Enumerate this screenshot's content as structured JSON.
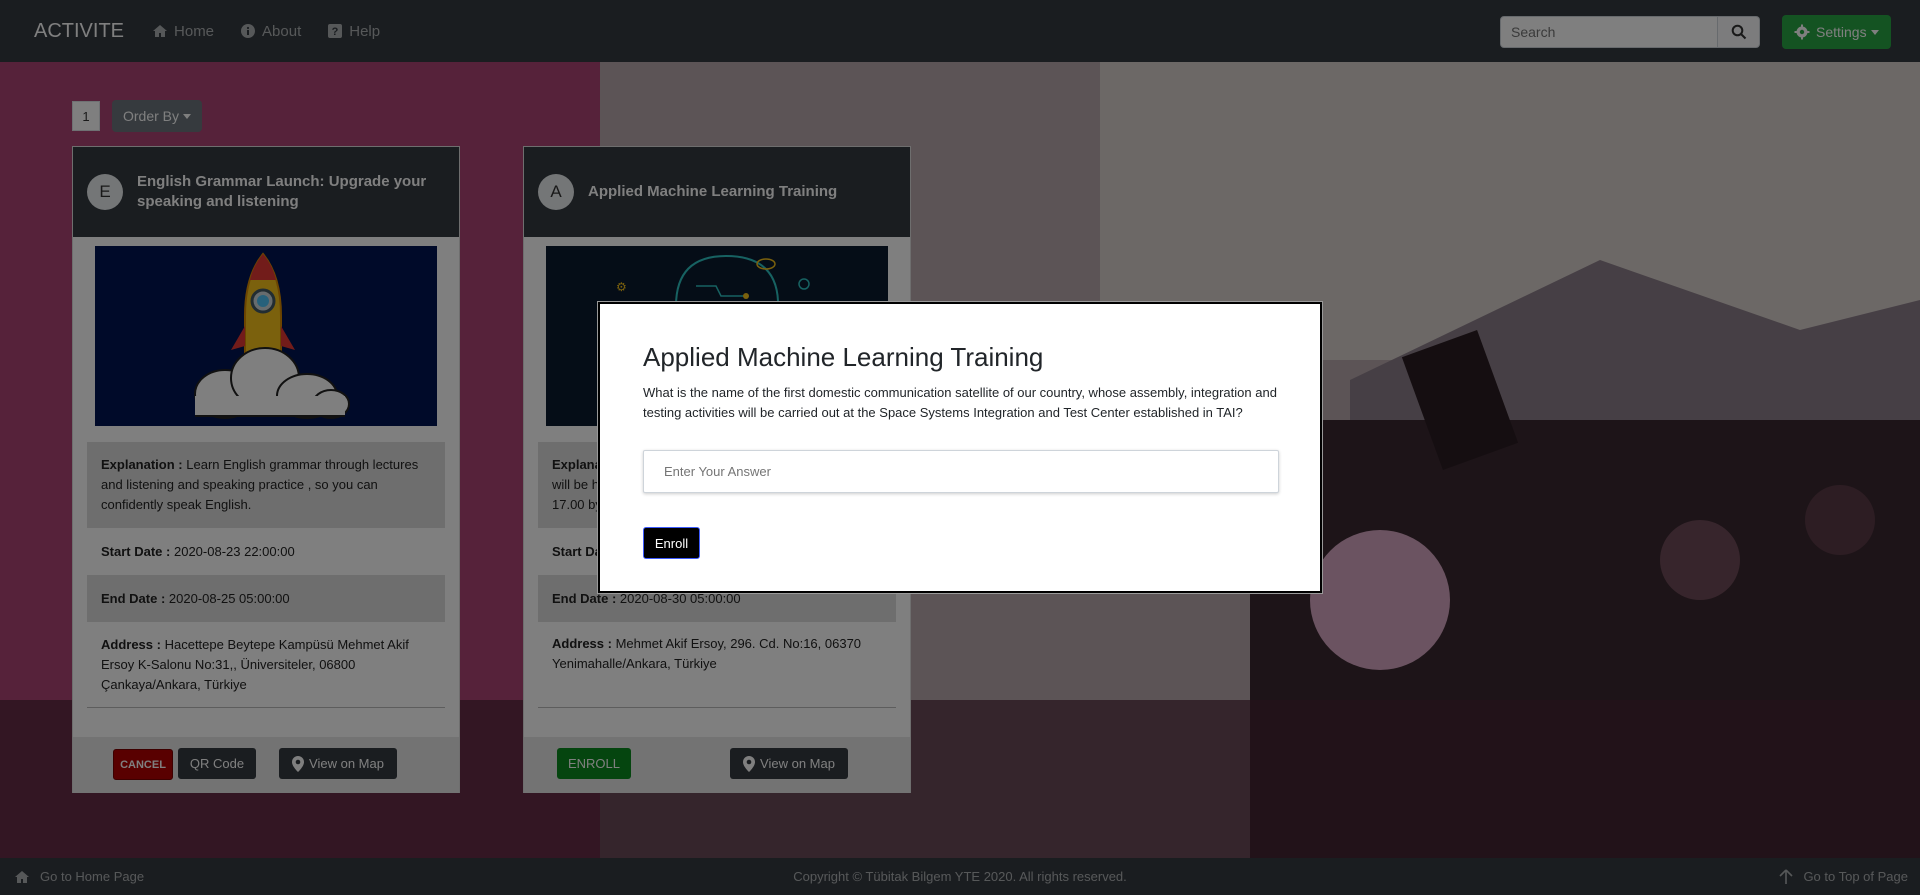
{
  "navbar": {
    "brand": "ACTIVITE",
    "links": [
      {
        "label": "Home",
        "icon": "home-icon"
      },
      {
        "label": "About",
        "icon": "info-icon"
      },
      {
        "label": "Help",
        "icon": "question-icon"
      }
    ],
    "search_placeholder": "Search",
    "settings_label": "Settings"
  },
  "toolbar": {
    "page_number": "1",
    "order_by_label": "Order By"
  },
  "cards": [
    {
      "avatar_letter": "E",
      "title": "English Grammar Launch: Upgrade your speaking and listening",
      "explanation_label": "Explanation :",
      "explanation": "Learn English grammar through lectures and listening and speaking practice , so you can confidently speak English.",
      "start_label": "Start Date :",
      "start_date": "2020-08-23 22:00:00",
      "end_label": "End Date :",
      "end_date": "2020-08-25 05:00:00",
      "address_label": "Address :",
      "address": "Hacettepe Beytepe Kampüsü Mehmet Akif Ersoy K-Salonu No:31,, Üniversiteler, 06800 Çankaya/Ankara, Türkiye",
      "cancel_label": "CANCEL",
      "qr_label": "QR Code",
      "map_label": "View on Map"
    },
    {
      "avatar_letter": "A",
      "title": "Applied Machine Learning Training",
      "explanation_label": "Explana",
      "explanation_line2": "will be h",
      "explanation_line3": "17.00 by",
      "start_label": "Start Da",
      "end_label": "End Date :",
      "end_date": "2020-08-30 05:00:00",
      "address_label": "Address :",
      "address": "Mehmet Akif Ersoy, 296. Cd. No:16, 06370 Yenimahalle/Ankara, Türkiye",
      "enroll_label": "ENROLL",
      "map_label": "View on Map"
    }
  ],
  "modal": {
    "title": "Applied Machine Learning Training",
    "question": "What is the name of the first domestic communication satellite of our country, whose assembly, integration and testing activities will be carried out at the Space Systems Integration and Test Center established in TAI?",
    "answer_placeholder": "Enter Your Answer",
    "enroll_label": "Enroll"
  },
  "footer": {
    "home_link": "Go to Home Page",
    "copyright": "Copyright © Tübitak Bilgem YTE 2020. All rights reserved.",
    "top_link": "Go to Top of Page"
  },
  "colors": {
    "navbar": "#343a40",
    "settings_green": "#28a745",
    "cancel_red": "#b30000",
    "enroll_green": "#0b8a1f",
    "dark_button": "#343a40"
  }
}
